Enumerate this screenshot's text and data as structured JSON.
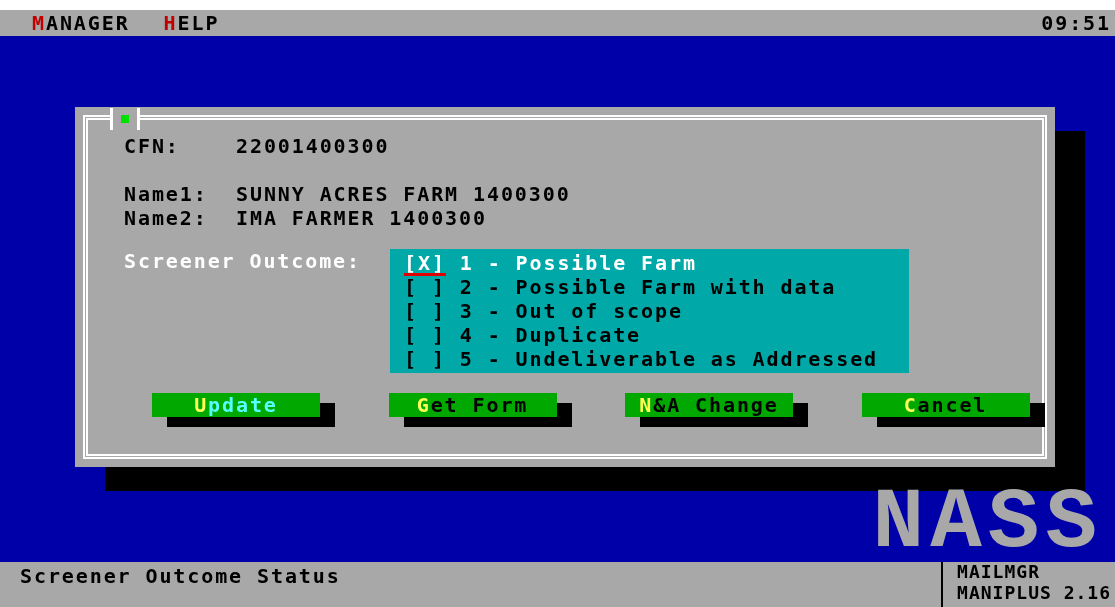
{
  "menu_bar": {
    "items": [
      {
        "label": "MANAGER"
      },
      {
        "label": "HELP"
      }
    ],
    "clock": "09:51"
  },
  "dialog": {
    "id_field": {
      "label": "CFN:",
      "value": "22001400300"
    },
    "name_fields": [
      {
        "label": "Name1:",
        "value": "SUNNY ACRES FARM 1400300"
      },
      {
        "label": "Name2:",
        "value": "IMA FARMER 1400300"
      }
    ],
    "outcome_label": "Screener Outcome:",
    "options": [
      {
        "mark": "[X]",
        "label": "1 - Possible Farm",
        "checked": true
      },
      {
        "mark": "[ ]",
        "label": "2 - Possible Farm with data",
        "checked": false
      },
      {
        "mark": "[ ]",
        "label": "3 - Out of scope",
        "checked": false
      },
      {
        "mark": "[ ]",
        "label": "4 - Duplicate",
        "checked": false
      },
      {
        "mark": "[ ]",
        "label": "5 - Undeliverable as Addressed",
        "checked": false
      }
    ],
    "buttons": [
      {
        "label": "Update",
        "focused": true
      },
      {
        "label": "Get Form",
        "focused": false
      },
      {
        "label": "N&A Change",
        "focused": false
      },
      {
        "label": "Cancel",
        "focused": false
      }
    ]
  },
  "logo": "NASS",
  "status_bar": {
    "message": "Screener Outcome Status",
    "module": "MAILMGR",
    "version": "MANIPLUS 2.16"
  }
}
